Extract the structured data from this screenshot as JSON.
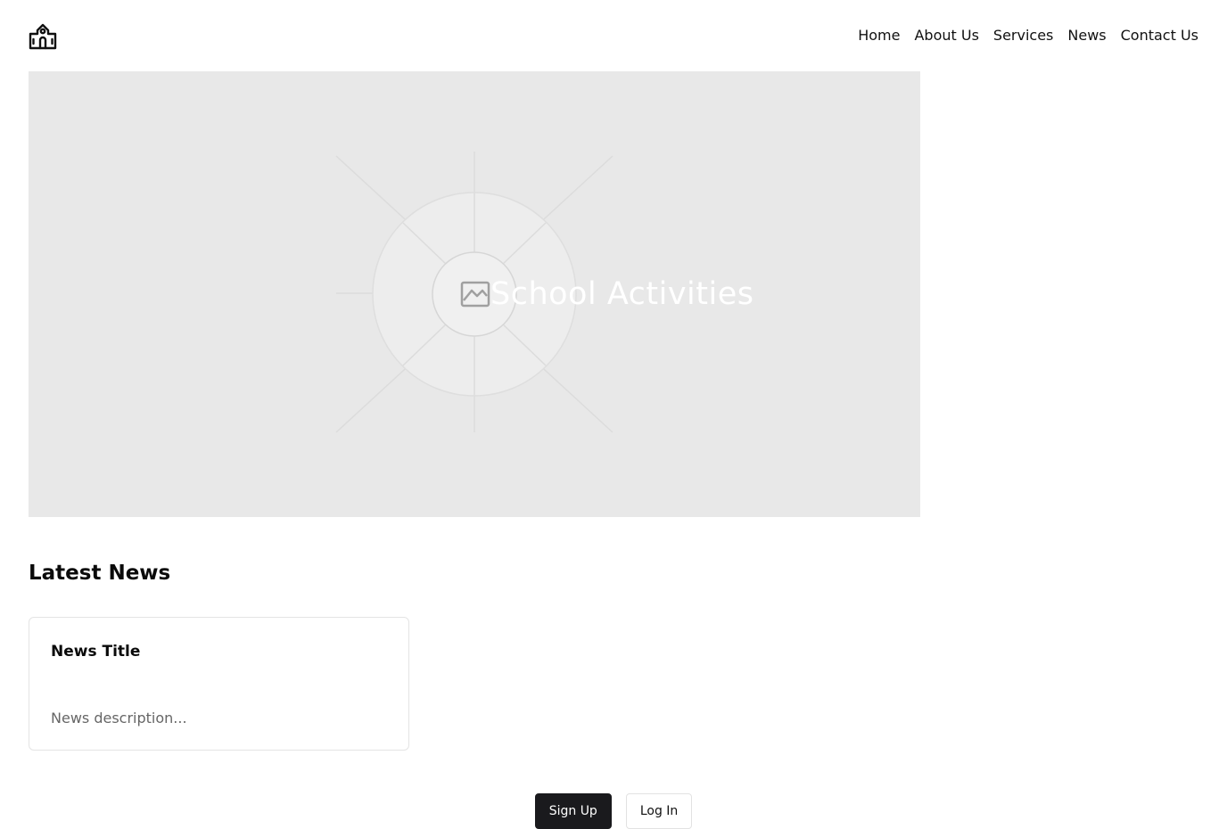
{
  "header": {
    "logo_icon": "school-building-icon",
    "nav": [
      "Home",
      "About Us",
      "Services",
      "News",
      "Contact Us"
    ]
  },
  "hero": {
    "title": "School Activities",
    "placeholder_icon": "image-icon",
    "background_color": "#e8e8e8"
  },
  "news": {
    "section_title": "Latest News",
    "cards": [
      {
        "title": "News Title",
        "description": "News description..."
      }
    ]
  },
  "actions": {
    "signup_label": "Sign Up",
    "login_label": "Log In"
  },
  "colors": {
    "primary_button": "#1a1a1d",
    "text": "#111111",
    "muted_text": "#666666",
    "border": "#e4e4e4"
  }
}
